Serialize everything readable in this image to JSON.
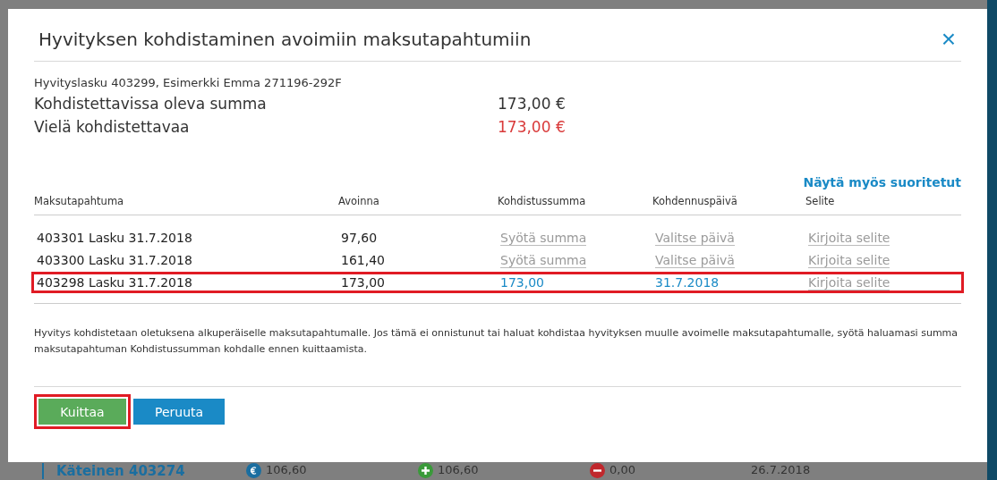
{
  "dialog": {
    "title": "Hyvityksen kohdistaminen avoimiin maksutapahtumiin",
    "close": "×",
    "invoice": "Hyvityslasku 403299, Esimerkki Emma 271196-292F",
    "summary": [
      {
        "label": "Kohdistettavissa oleva summa",
        "value": "173,00 €",
        "warning": false
      },
      {
        "label": "Vielä kohdistettavaa",
        "value": "173,00 €",
        "warning": true
      }
    ],
    "show_completed": "Näytä myös suoritetut",
    "table": {
      "columns": [
        "Maksutapahtuma",
        "Avoinna",
        "Kohdistussumma",
        "Kohdennuspäivä",
        "Selite"
      ],
      "rows": [
        {
          "transaction": "403301 Lasku 31.7.2018",
          "open": "97,60",
          "amount": {
            "placeholder": "Syötä summa"
          },
          "date": {
            "placeholder": "Valitse päivä"
          },
          "note": {
            "placeholder": "Kirjoita selite"
          },
          "highlighted": false
        },
        {
          "transaction": "403300 Lasku 31.7.2018",
          "open": "161,40",
          "amount": {
            "placeholder": "Syötä summa"
          },
          "date": {
            "placeholder": "Valitse päivä"
          },
          "note": {
            "placeholder": "Kirjoita selite"
          },
          "highlighted": false
        },
        {
          "transaction": "403298 Lasku 31.7.2018",
          "open": "173,00",
          "amount": {
            "value": "173,00"
          },
          "date": {
            "value": "31.7.2018"
          },
          "note": {
            "placeholder": "Kirjoita selite"
          },
          "highlighted": true
        }
      ]
    },
    "info": "Hyvitys kohdistetaan oletuksena alkuperäiselle maksutapahtumalle. Jos tämä ei onnistunut tai haluat kohdistaa hyvityksen muulle avoimelle maksutapahtumalle, syötä haluamasi summa maksutapahtuman Kohdistussumman kohdalle ennen kuittaamista.",
    "buttons": [
      {
        "label": "Kuittaa",
        "kind": "primary",
        "highlighted": true
      },
      {
        "label": "Peruuta",
        "kind": "secondary",
        "highlighted": false
      }
    ]
  },
  "background_row": {
    "name": "Käteinen 403274",
    "amounts": [
      {
        "kind": "euro",
        "value": "106,60"
      },
      {
        "kind": "plus",
        "value": "106,60"
      },
      {
        "kind": "minus",
        "value": "0,00"
      }
    ],
    "date": "26.7.2018"
  }
}
